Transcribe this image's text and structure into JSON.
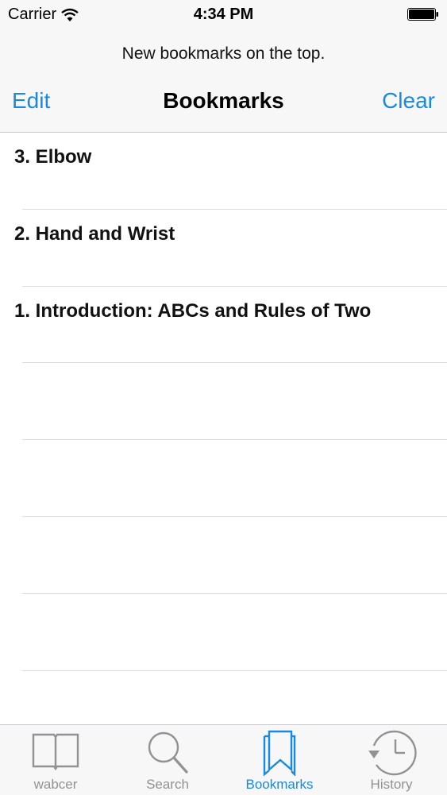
{
  "status": {
    "carrier": "Carrier",
    "time": "4:34 PM"
  },
  "header": {
    "prompt": "New bookmarks on the top.",
    "title": "Bookmarks",
    "left_button": "Edit",
    "right_button": "Clear"
  },
  "bookmarks": [
    "3. Elbow",
    "2. Hand and Wrist",
    "1. Introduction: ABCs and Rules of Two"
  ],
  "tabs": [
    {
      "label": "wabcer",
      "icon": "book-icon",
      "active": false
    },
    {
      "label": "Search",
      "icon": "magnifier-icon",
      "active": false
    },
    {
      "label": "Bookmarks",
      "icon": "bookmarks-icon",
      "active": true
    },
    {
      "label": "History",
      "icon": "clock-icon",
      "active": false
    }
  ],
  "colors": {
    "accent": "#1a8ae0",
    "inactive": "#929292"
  }
}
